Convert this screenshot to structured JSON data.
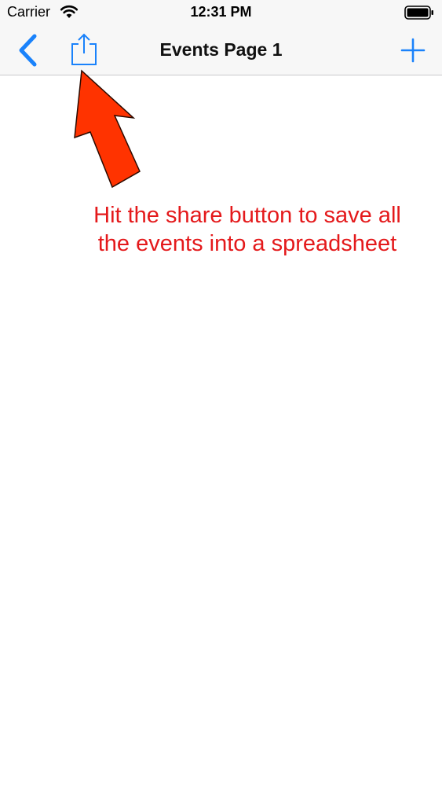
{
  "status_bar": {
    "carrier": "Carrier",
    "time": "12:31 PM"
  },
  "nav_bar": {
    "title": "Events Page 1",
    "back_icon": "chevron-left-icon",
    "share_icon": "share-icon",
    "add_icon": "plus-icon",
    "tint_color": "#1a82fb"
  },
  "annotation": {
    "line1": "Hit the share button to save all",
    "line2": "the events into a spreadsheet",
    "text_color": "#e4191b",
    "arrow_color": "#ff3300"
  }
}
